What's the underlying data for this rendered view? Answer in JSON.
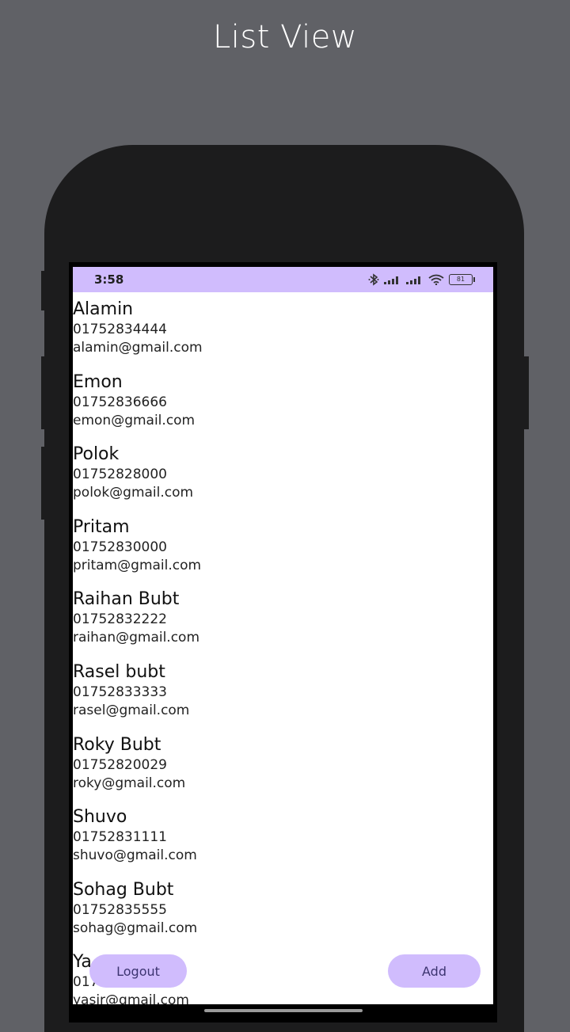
{
  "page": {
    "title": "List View"
  },
  "status_bar": {
    "time": "3:58",
    "battery": "81"
  },
  "contacts": [
    {
      "name": "Alamin",
      "phone": "01752834444",
      "email": "alamin@gmail.com"
    },
    {
      "name": "Emon",
      "phone": "01752836666",
      "email": "emon@gmail.com"
    },
    {
      "name": "Polok",
      "phone": "01752828000",
      "email": "polok@gmail.com"
    },
    {
      "name": "Pritam",
      "phone": "01752830000",
      "email": "pritam@gmail.com"
    },
    {
      "name": "Raihan Bubt",
      "phone": "01752832222",
      "email": "raihan@gmail.com"
    },
    {
      "name": "Rasel bubt",
      "phone": "01752833333",
      "email": "rasel@gmail.com"
    },
    {
      "name": "Roky Bubt",
      "phone": "01752820029",
      "email": "roky@gmail.com"
    },
    {
      "name": "Shuvo",
      "phone": "01752831111",
      "email": "shuvo@gmail.com"
    },
    {
      "name": "Sohag Bubt",
      "phone": "01752835555",
      "email": "sohag@gmail.com"
    },
    {
      "name": "Ya",
      "phone": "017",
      "email": "yasir@gmail.com"
    }
  ],
  "buttons": {
    "logout": "Logout",
    "add": "Add"
  },
  "colors": {
    "accent": "#d0bcfd",
    "background": "#606166",
    "phone_body": "#1c1c1d"
  },
  "icons": [
    "bluetooth-icon",
    "signal-icon",
    "signal-icon",
    "wifi-icon",
    "battery-icon"
  ]
}
